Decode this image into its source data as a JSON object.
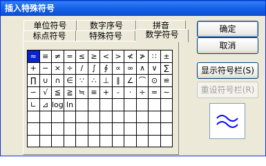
{
  "window": {
    "title": "插入特殊符号"
  },
  "tabs": {
    "row_back": [
      "单位符号",
      "数字序号",
      "拼音"
    ],
    "row_front": [
      "标点符号",
      "特殊符号",
      "数学符号"
    ],
    "active": "数学符号"
  },
  "symbols": [
    [
      "≈",
      "≡",
      "≠",
      "=",
      "≤",
      "≥",
      "<",
      ">",
      "≮",
      "≯",
      "∷",
      "±"
    ],
    [
      "+",
      "−",
      "×",
      "÷",
      "/",
      "∫",
      "∮",
      "∝",
      "∞",
      "∧",
      "∨",
      "∑"
    ],
    [
      "∏",
      "∪",
      "∩",
      "∈",
      "∵",
      "∴",
      "⊥",
      "∥",
      "∠",
      "⌒",
      "⊙",
      "≌"
    ],
    [
      "∽",
      "√",
      "≦",
      "≧",
      "≒",
      "≡",
      "+",
      "-",
      "·",
      "÷",
      "=",
      "∼"
    ],
    [
      "∟",
      "⊿",
      "log",
      "ln",
      "",
      "",
      "",
      "",
      "",
      "",
      "",
      ""
    ],
    [
      "",
      "",
      "",
      "",
      "",
      "",
      "",
      "",
      "",
      "",
      "",
      ""
    ],
    [
      "",
      "",
      "",
      "",
      "",
      "",
      "",
      "",
      "",
      "",
      "",
      ""
    ],
    [
      "",
      "",
      "",
      "",
      "",
      "",
      "",
      "",
      "",
      "",
      "",
      ""
    ]
  ],
  "selected_symbol": "≈",
  "buttons": {
    "ok": "确定",
    "cancel": "取消",
    "show_symbol_bar": "显示符号栏(S)",
    "reset_symbol_bar": "重设符号栏(R)"
  },
  "colors": {
    "titlebar": "#0b5ed7",
    "selection": "#0a24c8",
    "preview_stroke": "#0000ff"
  }
}
